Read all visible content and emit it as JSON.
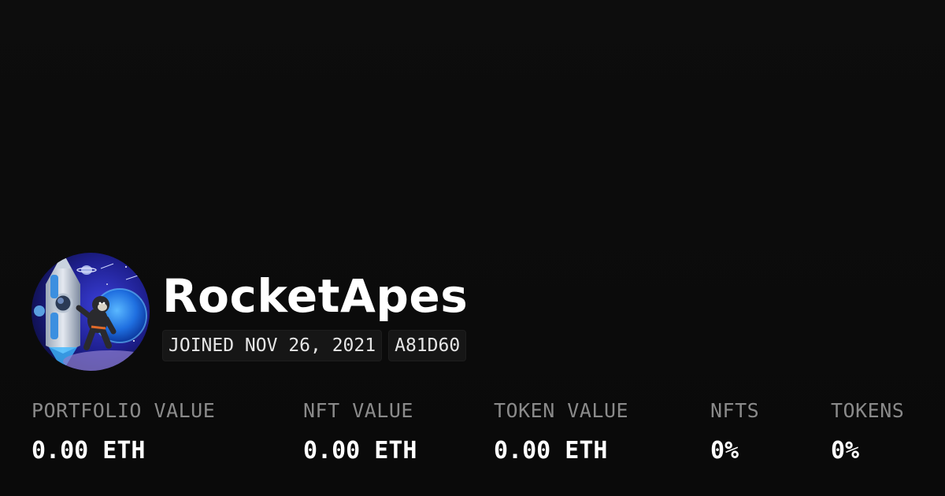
{
  "profile": {
    "name": "RocketApes",
    "joined": "JOINED NOV 26, 2021",
    "address_tag": "A81D60",
    "avatar_icon": "rocket-ape-avatar-icon"
  },
  "stats": [
    {
      "label": "PORTFOLIO VALUE",
      "value": "0.00 ETH"
    },
    {
      "label": "NFT VALUE",
      "value": "0.00 ETH"
    },
    {
      "label": "TOKEN VALUE",
      "value": "0.00 ETH"
    },
    {
      "label": "NFTS",
      "value": "0%"
    },
    {
      "label": "TOKENS",
      "value": "0%"
    }
  ],
  "colors": {
    "background": "#0b0b0b",
    "text": "#ffffff",
    "muted": "#8a8a8a",
    "badge_bg": "#161616"
  }
}
